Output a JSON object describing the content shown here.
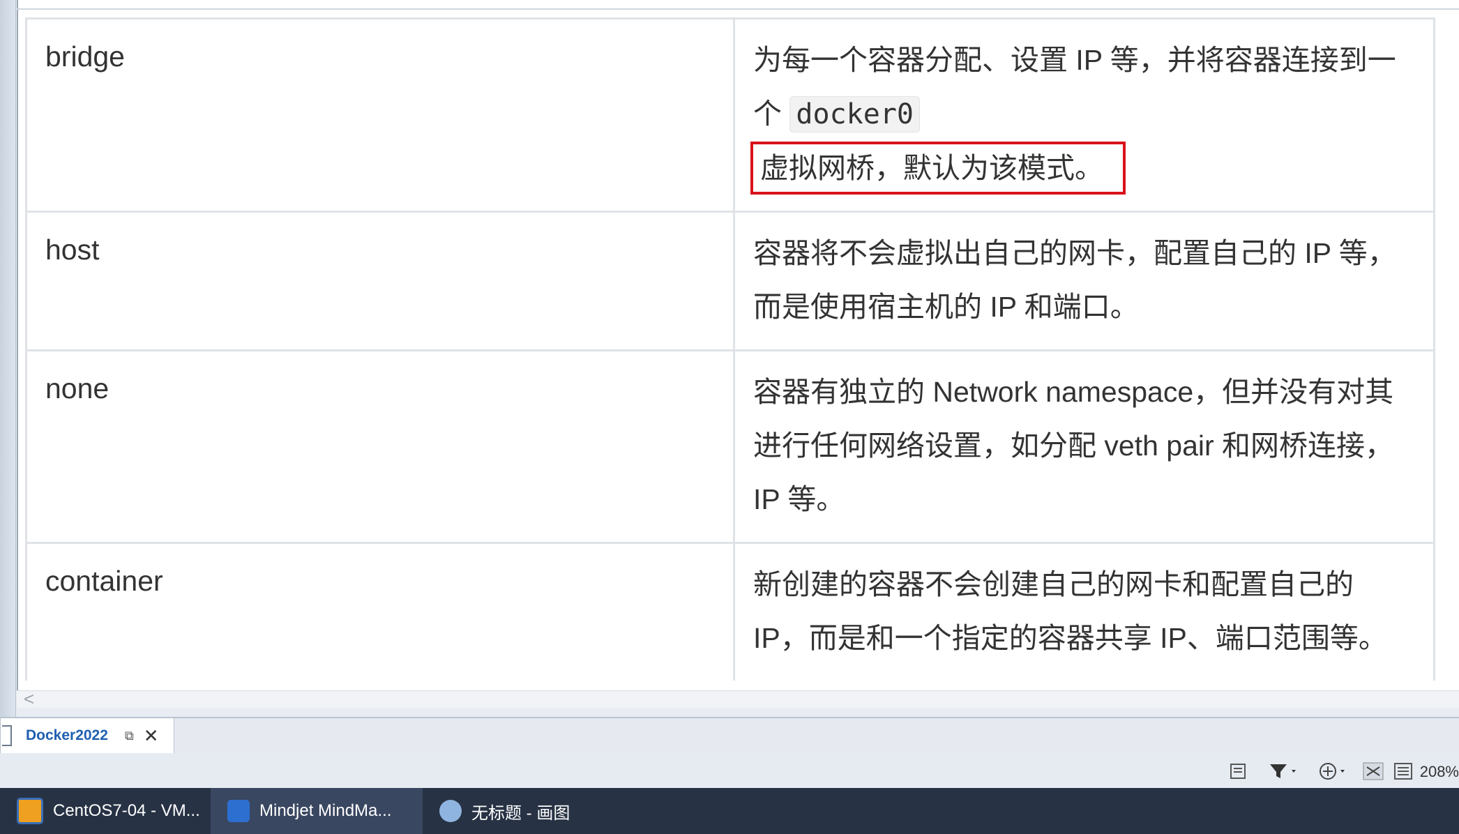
{
  "table": {
    "rows": [
      {
        "mode": "bridge",
        "desc_part1": "为每一个容器分配、设置 IP 等，并将容器连接到一个 ",
        "desc_code": "docker0",
        "desc_highlight": "虚拟网桥，默认为该模式。"
      },
      {
        "mode": "host",
        "desc": "容器将不会虚拟出自己的网卡，配置自己的 IP 等，而是使用宿主机的 IP 和端口。"
      },
      {
        "mode": "none",
        "desc": "容器有独立的 Network namespace，但并没有对其进行任何网络设置，如分配 veth pair 和网桥连接，IP 等。"
      },
      {
        "mode": "container",
        "desc": "新创建的容器不会创建自己的网卡和配置自己的 IP，而是和一个指定的容器共享 IP、端口范围等。"
      }
    ]
  },
  "scrollbar": {
    "left_arrow": "<"
  },
  "document_tab": {
    "label": "Docker2022",
    "pin_glyph": "⧉",
    "close_glyph": "✕"
  },
  "statusbar": {
    "icons": [
      "page-icon",
      "filter-icon",
      "focus-icon",
      "layout-icon",
      "outline-icon"
    ],
    "zoom": "208%"
  },
  "taskbar": {
    "items": [
      {
        "label": "CentOS7-04 - VM...",
        "icon": "vmware-icon",
        "color": "#f0a020"
      },
      {
        "label": "Mindjet MindMa...",
        "icon": "mindmanager-icon",
        "color": "#2c6fd1"
      },
      {
        "label": "无标题 - 画图",
        "icon": "paint-icon",
        "color": "#8fb4e0"
      }
    ]
  }
}
